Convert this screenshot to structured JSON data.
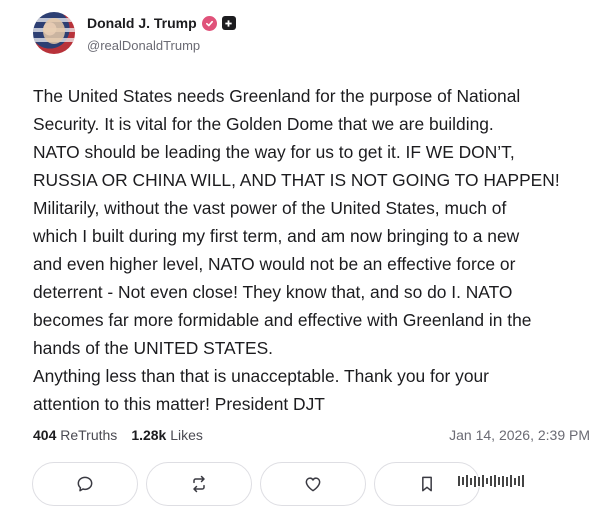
{
  "author": {
    "display_name": "Donald J. Trump",
    "handle": "@realDonaldTrump",
    "avatar_icon": "profile-avatar",
    "verified_color": "#e0527a"
  },
  "post": {
    "text": "The United States needs Greenland for the purpose of National\nSecurity. It is vital for the Golden Dome that we are building.\nNATO should be leading the way for us to get it. IF WE DON’T,\nRUSSIA OR CHINA WILL, AND THAT IS NOT GOING TO HAPPEN!\nMilitarily, without the vast power of the United States, much of\nwhich I built during my first term, and am now bringing to a new\nand even higher level, NATO would not be an effective force or\ndeterrent - Not even close! They know that, and so do I. NATO\nbecomes far more formidable and effective with Greenland in the\nhands of the UNITED STATES.\nAnything less than that is unacceptable. Thank you for your\nattention to this matter! President DJT"
  },
  "stats": {
    "retruths_count": "404",
    "retruths_label": "ReTruths",
    "likes_count": "1.28k",
    "likes_label": "Likes",
    "timestamp": "Jan 14, 2026, 2:39 PM"
  },
  "actions": [
    {
      "name": "reply",
      "icon": "comment-icon"
    },
    {
      "name": "retruth",
      "icon": "repost-icon"
    },
    {
      "name": "like",
      "icon": "heart-icon"
    },
    {
      "name": "bookmark",
      "icon": "bookmark-icon"
    }
  ]
}
